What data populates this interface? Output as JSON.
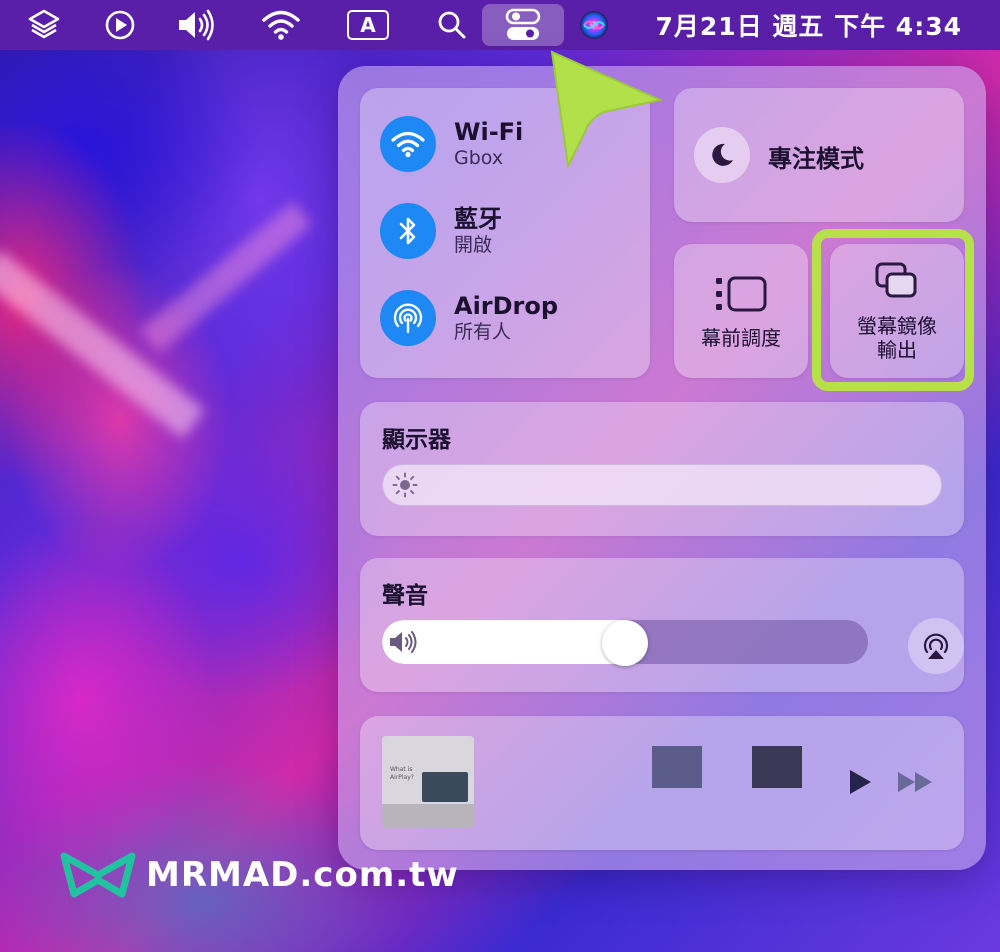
{
  "menubar": {
    "clock": "7月21日 週五  下午 4:34",
    "input_method": "A"
  },
  "control_center": {
    "wifi": {
      "title": "Wi-Fi",
      "subtitle": "Gbox"
    },
    "bluetooth": {
      "title": "藍牙",
      "subtitle": "開啟"
    },
    "airdrop": {
      "title": "AirDrop",
      "subtitle": "所有人"
    },
    "focus": {
      "title": "專注模式"
    },
    "stage_manager": {
      "label": "幕前調度"
    },
    "screen_mirroring": {
      "label_line1": "螢幕鏡像",
      "label_line2": "輸出"
    },
    "display": {
      "title": "顯示器",
      "brightness": 0.0
    },
    "sound": {
      "title": "聲音",
      "volume": 0.5
    },
    "now_playing": {
      "artwork_text": "What is AirPlay?"
    }
  },
  "watermark": {
    "text": "MRMAD.com.tw"
  },
  "colors": {
    "accent": "#1e88f5",
    "highlight": "#b8e04a",
    "menubar": "#5a1fa8"
  }
}
